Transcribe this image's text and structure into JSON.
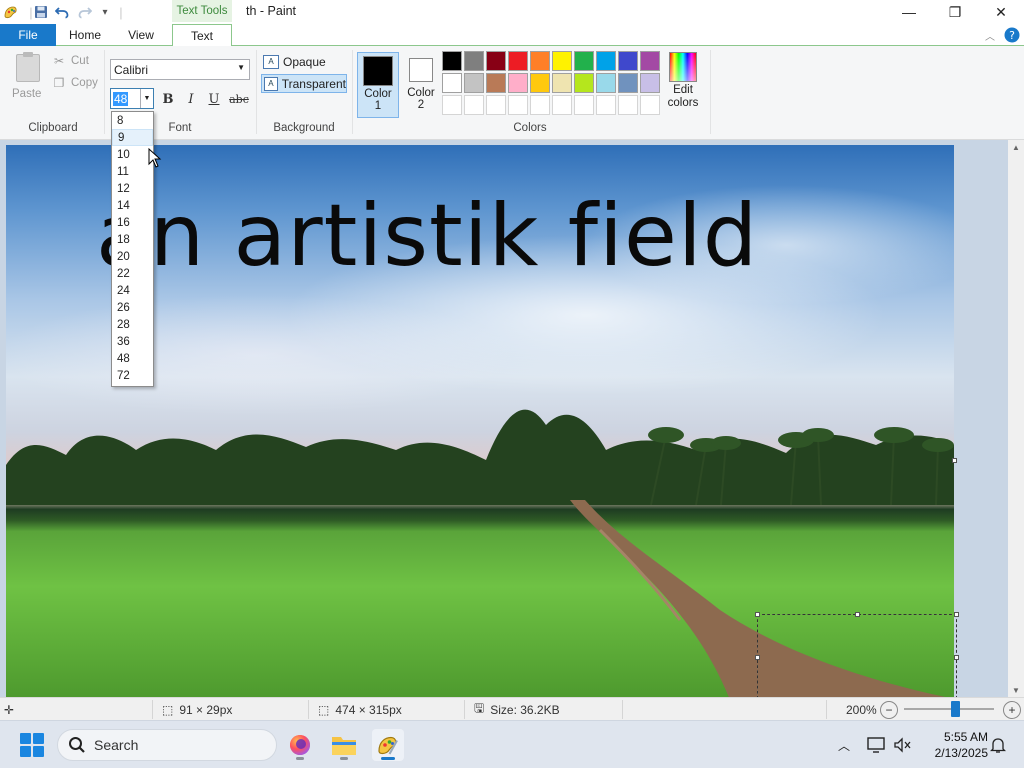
{
  "window": {
    "title": "th - Paint",
    "context_tab": "Text Tools",
    "minimize": "—",
    "maximize": "❐",
    "close": "✕"
  },
  "tabs": {
    "file": "File",
    "home": "Home",
    "view": "View",
    "text": "Text"
  },
  "ribbon": {
    "clipboard": {
      "paste": "Paste",
      "cut": "Cut",
      "copy": "Copy",
      "label": "Clipboard"
    },
    "font": {
      "family": "Calibri",
      "size": "48",
      "bold": "B",
      "italic": "I",
      "underline": "U",
      "strikethrough": "abc",
      "label": "Font"
    },
    "background": {
      "opaque": "Opaque",
      "transparent": "Transparent",
      "label": "Background",
      "selected": "transparent"
    },
    "colors": {
      "color1_label_a": "Color",
      "color1_label_b": "1",
      "color2_label_a": "Color",
      "color2_label_b": "2",
      "color1": "#000000",
      "color2": "#ffffff",
      "edit_a": "Edit",
      "edit_b": "colors",
      "label": "Colors",
      "palette_row1": [
        "#000000",
        "#7f7f7f",
        "#880015",
        "#ed1c24",
        "#ff7f27",
        "#fff200",
        "#22b14c",
        "#00a2e8",
        "#3f48cc",
        "#a349a4"
      ],
      "palette_row2": [
        "#ffffff",
        "#c3c3c3",
        "#b97a57",
        "#ffaec9",
        "#ffc90e",
        "#efe4b0",
        "#b5e61d",
        "#99d9ea",
        "#7092be",
        "#c8bfe7"
      ]
    }
  },
  "font_size_options": [
    "8",
    "9",
    "10",
    "11",
    "12",
    "14",
    "16",
    "18",
    "20",
    "22",
    "24",
    "26",
    "28",
    "36",
    "48",
    "72"
  ],
  "font_size_hovered": "9",
  "canvas": {
    "text": "an artistik field"
  },
  "statusbar": {
    "selection_size": "91 × 29px",
    "image_size": "474 × 315px",
    "file_size": "Size: 36.2KB",
    "zoom": "200%",
    "zoom_out": "−",
    "zoom_in": "+"
  },
  "taskbar": {
    "search": "Search",
    "time": "5:55 AM",
    "date": "2/13/2025"
  }
}
